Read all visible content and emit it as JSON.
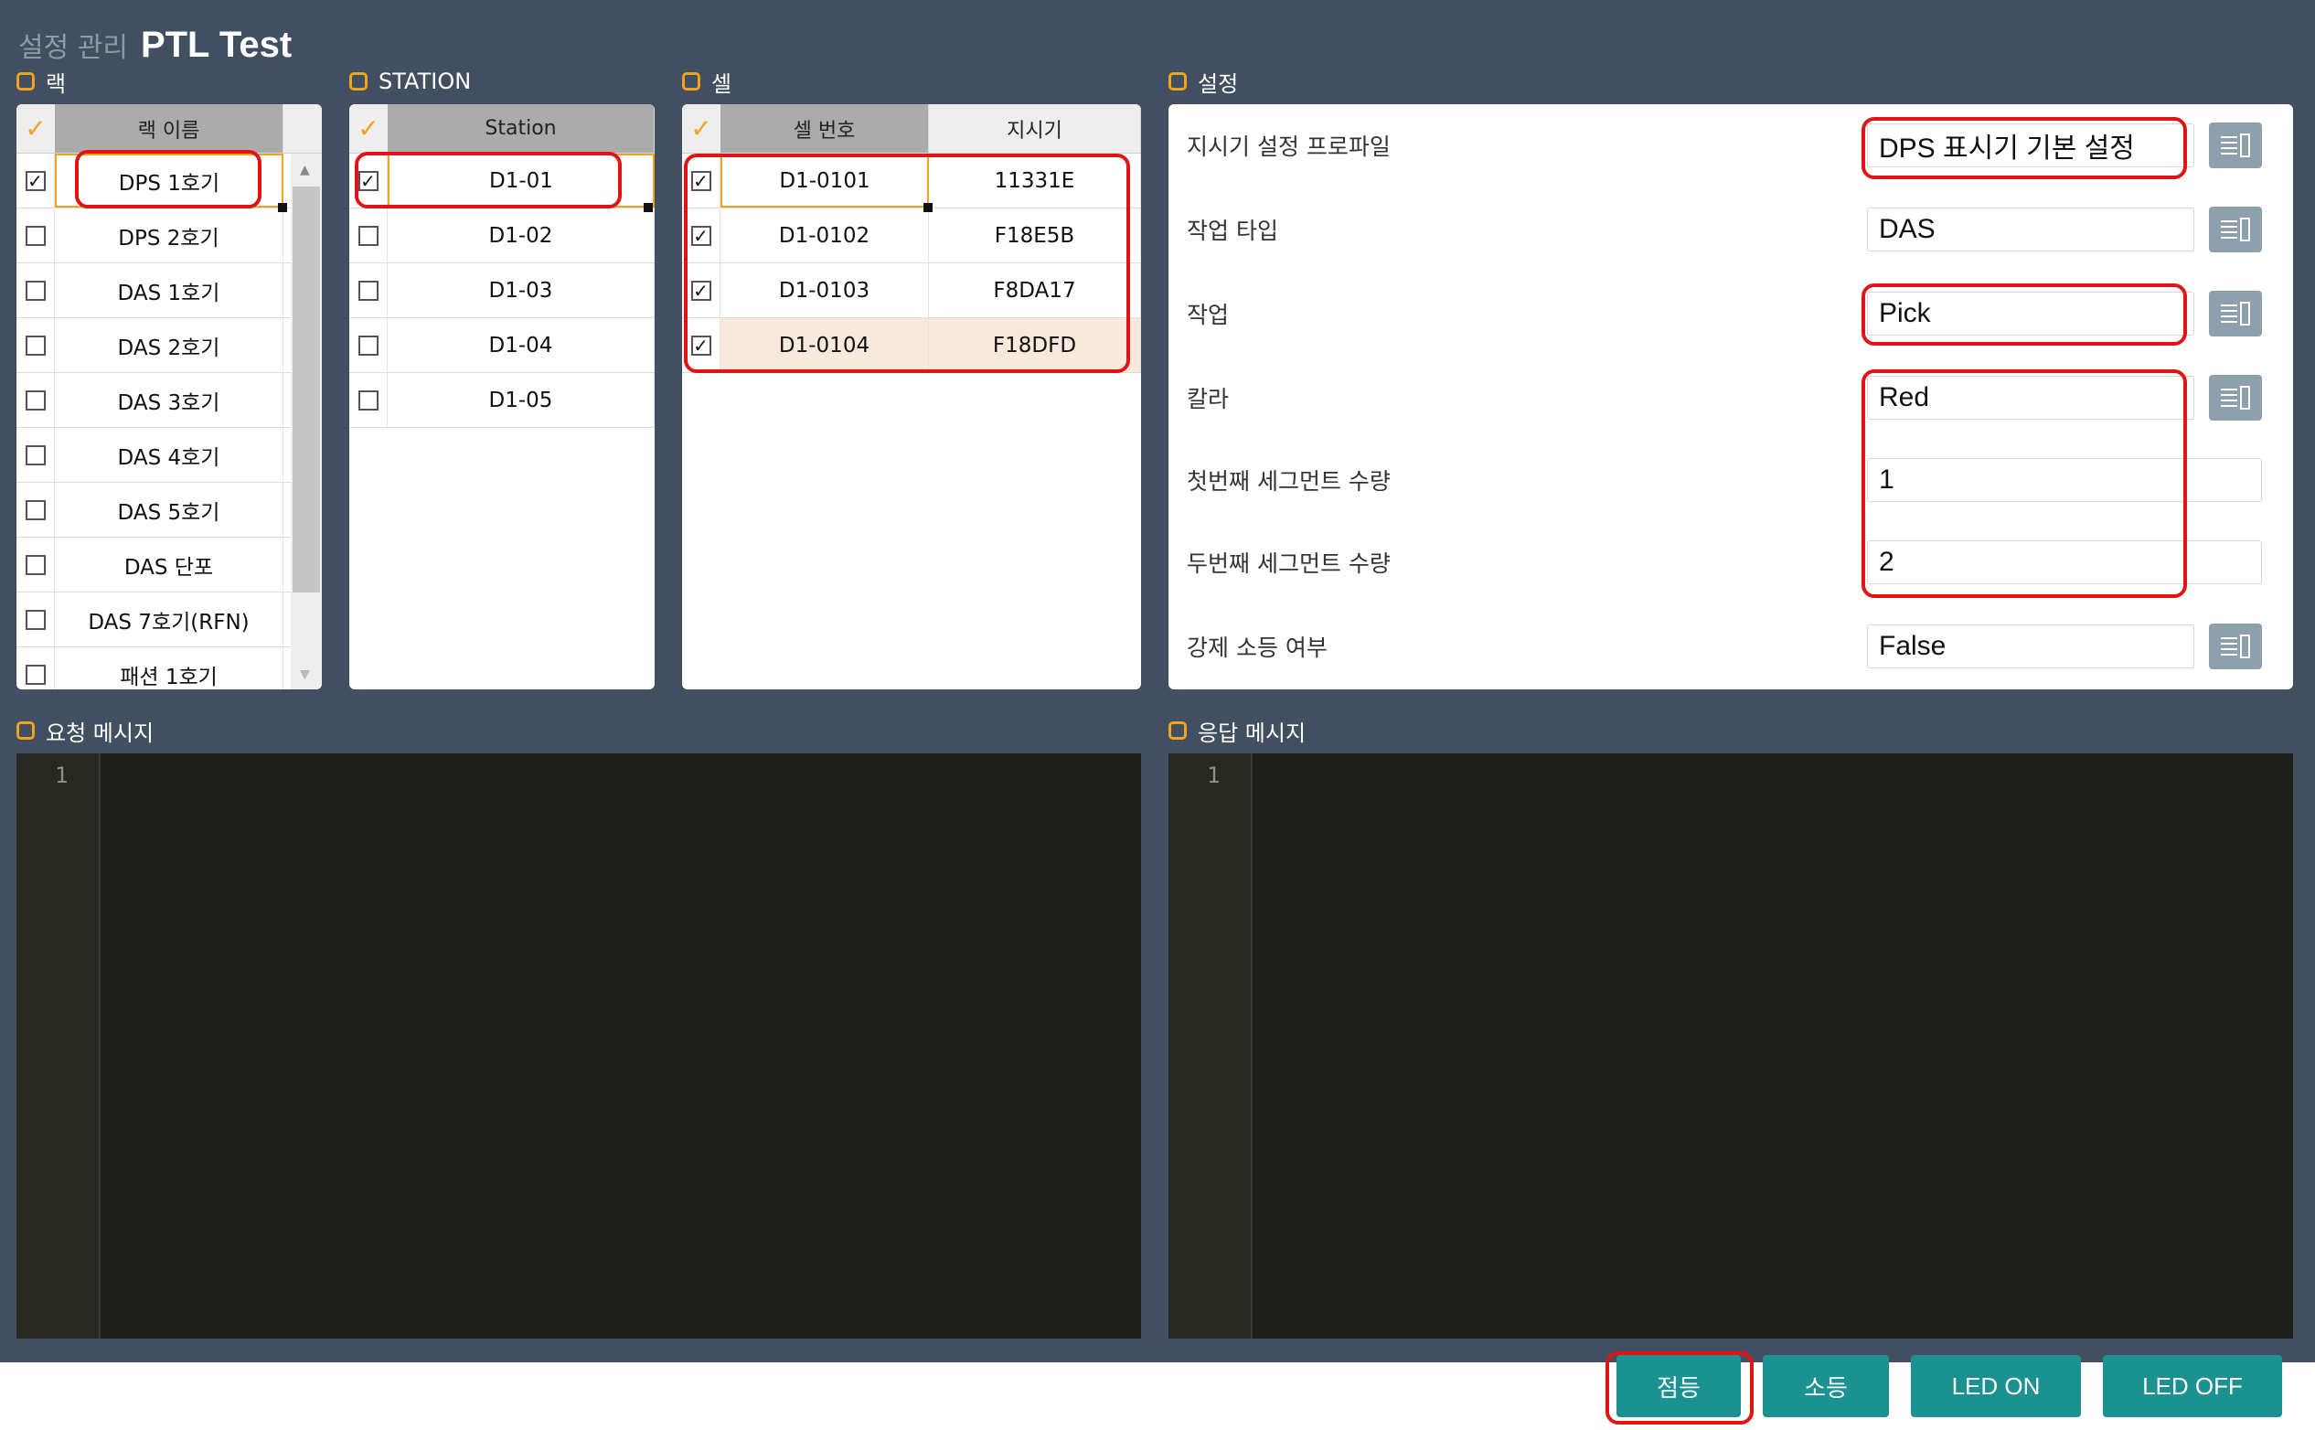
{
  "header": {
    "crumb": "설정 관리",
    "title": "PTL Test"
  },
  "sections": {
    "rack": "랙",
    "station": "STATION",
    "cell": "셀",
    "settings": "설정",
    "request": "요청 메시지",
    "response": "응답 메시지"
  },
  "rack_grid": {
    "header": "랙 이름",
    "rows": [
      {
        "name": "DPS 1호기",
        "checked": true
      },
      {
        "name": "DPS 2호기",
        "checked": false
      },
      {
        "name": "DAS 1호기",
        "checked": false
      },
      {
        "name": "DAS 2호기",
        "checked": false
      },
      {
        "name": "DAS 3호기",
        "checked": false
      },
      {
        "name": "DAS 4호기",
        "checked": false
      },
      {
        "name": "DAS 5호기",
        "checked": false
      },
      {
        "name": "DAS 단포",
        "checked": false
      },
      {
        "name": "DAS 7호기(RFN)",
        "checked": false
      },
      {
        "name": "패션 1호기",
        "checked": false
      }
    ]
  },
  "station_grid": {
    "header": "Station",
    "rows": [
      {
        "name": "D1-01",
        "checked": true
      },
      {
        "name": "D1-02",
        "checked": false
      },
      {
        "name": "D1-03",
        "checked": false
      },
      {
        "name": "D1-04",
        "checked": false
      },
      {
        "name": "D1-05",
        "checked": false
      }
    ]
  },
  "cell_grid": {
    "headers": [
      "셀 번호",
      "지시기"
    ],
    "rows": [
      {
        "cell": "D1-0101",
        "indicator": "11331E",
        "checked": true
      },
      {
        "cell": "D1-0102",
        "indicator": "F18E5B",
        "checked": true
      },
      {
        "cell": "D1-0103",
        "indicator": "F8DA17",
        "checked": true
      },
      {
        "cell": "D1-0104",
        "indicator": "F18DFD",
        "checked": true
      }
    ]
  },
  "settings": [
    {
      "label": "지시기 설정 프로파일",
      "value": "DPS 표시기 기본 설정",
      "has_button": true
    },
    {
      "label": "작업 타입",
      "value": "DAS",
      "has_button": true
    },
    {
      "label": "작업",
      "value": "Pick",
      "has_button": true
    },
    {
      "label": "칼라",
      "value": "Red",
      "has_button": true
    },
    {
      "label": "첫번째 세그먼트 수량",
      "value": "1",
      "has_button": false
    },
    {
      "label": "두번째 세그먼트 수량",
      "value": "2",
      "has_button": false
    },
    {
      "label": "강제 소등 여부",
      "value": "False",
      "has_button": true
    }
  ],
  "editors": {
    "request_line": "1",
    "response_line": "1"
  },
  "buttons": {
    "light_on": "점등",
    "light_off": "소등",
    "led_on": "LED ON",
    "led_off": "LED OFF"
  },
  "colors": {
    "background": "#424f61",
    "accent": "#f1a31b",
    "button": "#1c9191",
    "highlight": "#e01414"
  },
  "icons": {
    "list_button": "list-detail-icon",
    "checkmark": "checkmark-icon"
  }
}
